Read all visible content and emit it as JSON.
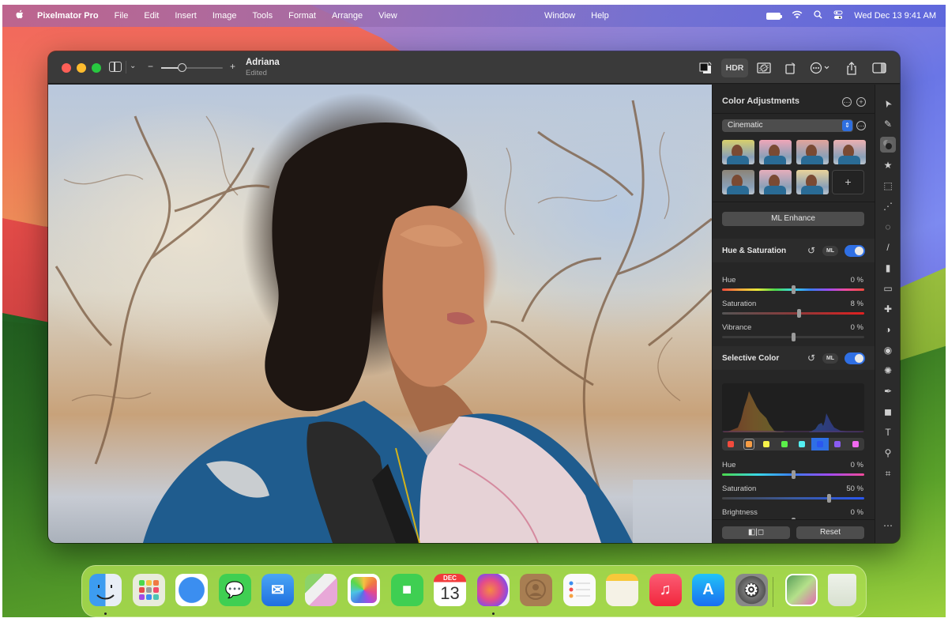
{
  "menubar": {
    "apple": "",
    "app_name": "Pixelmator Pro",
    "menus": [
      "File",
      "Edit",
      "Insert",
      "Image",
      "Tools",
      "Format",
      "Arrange",
      "View"
    ],
    "menus_center": [
      "Window",
      "Help"
    ],
    "status_icons": [
      "battery-icon",
      "wifi-icon",
      "search-icon",
      "control-center-icon"
    ],
    "clock": "Wed Dec 13  9:41 AM"
  },
  "window": {
    "title": "Adriana",
    "subtitle": "Edited",
    "zoom_minus": "−",
    "zoom_plus": "+",
    "zoom_level": 0.33,
    "toolbar_right": {
      "hdr_label": "HDR",
      "icons": [
        "color-swap-icon",
        "hdr-button",
        "mask-icon",
        "rotate-icon",
        "more-icon",
        "share-icon",
        "sidebar-right-icon"
      ]
    }
  },
  "panel": {
    "title": "Color Adjustments",
    "preset_select": "Cinematic",
    "presets": [
      {
        "name": "preset-1",
        "tint": "#d7cf6c"
      },
      {
        "name": "preset-2",
        "tint": "#f0a6b8"
      },
      {
        "name": "preset-3",
        "tint": "#e2a49b"
      },
      {
        "name": "preset-4",
        "tint": "#ecb0b0"
      },
      {
        "name": "preset-5",
        "tint": "#8c8478"
      },
      {
        "name": "preset-6",
        "tint": "#e6aebb"
      },
      {
        "name": "preset-7",
        "tint": "#ead39a"
      }
    ],
    "add_preset": "+",
    "ml_enhance": "ML Enhance",
    "hue_saturation": {
      "title": "Hue & Saturation",
      "ml": "ML",
      "enabled": true,
      "sliders": [
        {
          "label": "Hue",
          "value": "0 %",
          "position": 0.5
        },
        {
          "label": "Saturation",
          "value": "8 %",
          "position": 0.54
        },
        {
          "label": "Vibrance",
          "value": "0 %",
          "position": 0.5
        }
      ]
    },
    "selective_color": {
      "title": "Selective Color",
      "ml": "ML",
      "enabled": true,
      "swatches": [
        {
          "name": "red",
          "color": "#f24b3d"
        },
        {
          "name": "orange",
          "color": "#f79d44"
        },
        {
          "name": "yellow",
          "color": "#f7f24a"
        },
        {
          "name": "green",
          "color": "#5bf04a"
        },
        {
          "name": "cyan",
          "color": "#55f0f2"
        },
        {
          "name": "blue",
          "color": "#2a57f0"
        },
        {
          "name": "purple",
          "color": "#8a5cf2"
        },
        {
          "name": "magenta",
          "color": "#f26af0"
        }
      ],
      "selected_swatch": 5,
      "sliders": [
        {
          "label": "Hue",
          "value": "0 %",
          "position": 0.5
        },
        {
          "label": "Saturation",
          "value": "50 %",
          "position": 0.75
        },
        {
          "label": "Brightness",
          "value": "0 %",
          "position": 0.5
        }
      ]
    },
    "compare_label": "◧|◻",
    "reset_label": "Reset"
  },
  "tools": [
    "arrange-pointer-icon",
    "style-brush-icon",
    "color-adjust-icon",
    "effects-star-icon",
    "rect-select-icon",
    "lasso-select-icon",
    "magic-select-icon",
    "paint-brush-icon",
    "paint-bucket-icon",
    "eraser-icon",
    "retouch-bandage-icon",
    "warp-icon",
    "sharpen-blur-icon",
    "lighten-darken-icon",
    "pen-icon",
    "shapes-icon",
    "type-icon",
    "zoom-icon",
    "crop-icon",
    "more-tools-icon"
  ],
  "dock": {
    "apps": [
      {
        "name": "Finder",
        "running": true
      },
      {
        "name": "Launchpad",
        "running": false
      },
      {
        "name": "Safari",
        "running": false
      },
      {
        "name": "Messages",
        "running": false
      },
      {
        "name": "Mail",
        "running": false
      },
      {
        "name": "Maps",
        "running": false
      },
      {
        "name": "Photos",
        "running": false
      },
      {
        "name": "FaceTime",
        "running": false
      },
      {
        "name": "Calendar",
        "running": false,
        "month": "DEC",
        "day": "13"
      },
      {
        "name": "Pixelmator Pro",
        "running": true
      },
      {
        "name": "Contacts",
        "running": false
      },
      {
        "name": "Reminders",
        "running": false
      },
      {
        "name": "Notes",
        "running": false
      },
      {
        "name": "Music",
        "running": false
      },
      {
        "name": "App Store",
        "running": false
      },
      {
        "name": "System Settings",
        "running": false
      }
    ],
    "extras": [
      "Downloads stack",
      "Trash"
    ]
  }
}
